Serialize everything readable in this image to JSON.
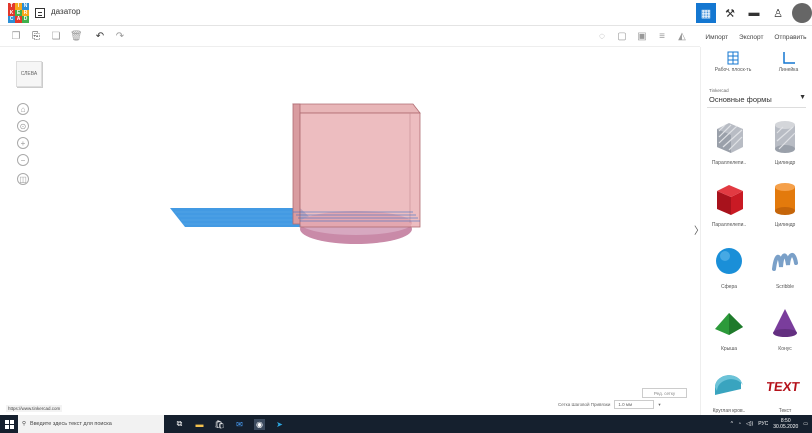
{
  "app": {
    "logo_letters": [
      "T",
      "I",
      "N",
      "K",
      "E",
      "R",
      "C",
      "A",
      "D"
    ],
    "logo_colors": [
      "#e2372b",
      "#f7a71a",
      "#2c8fd6",
      "#e2372b",
      "#3fb04b",
      "#f7a71a",
      "#2c8fd6",
      "#e2372b",
      "#3fb04b"
    ],
    "project_name": "дазатор",
    "accent": "#1477d1"
  },
  "header_right": {
    "icons": [
      "grid-view-icon",
      "hammer-icon",
      "briefcase-icon",
      "add-user-icon"
    ]
  },
  "toolbar": {
    "actions": {
      "import": "Импорт",
      "export": "Экспорт",
      "send": "Отправить"
    }
  },
  "canvas": {
    "viewcube_label": "СЛЕВА",
    "edit_grid_label": "Ред. сетку",
    "snap_label": "Сетка Шаговой Привязки",
    "snap_value": "1.0 мм",
    "url": "https://www.tinkercad.com"
  },
  "panel": {
    "workplane_label": "Рабоч. плоск-ть",
    "ruler_label": "Линейка",
    "library_label": "Tinkercad",
    "library_value": "Основные формы",
    "shapes": [
      {
        "label": "Параллелепи..",
        "icon": "box-hole-icon"
      },
      {
        "label": "Цилиндр",
        "icon": "cylinder-hole-icon"
      },
      {
        "label": "Параллелепи..",
        "icon": "box-icon"
      },
      {
        "label": "Цилиндр",
        "icon": "cylinder-icon"
      },
      {
        "label": "Сфера",
        "icon": "sphere-icon"
      },
      {
        "label": "Scribble",
        "icon": "scribble-icon"
      },
      {
        "label": "Крыша",
        "icon": "roof-icon"
      },
      {
        "label": "Конус",
        "icon": "cone-icon"
      },
      {
        "label": "Круглая кров..",
        "icon": "round-roof-icon"
      },
      {
        "label": "Текст",
        "icon": "text-icon"
      }
    ]
  },
  "taskbar": {
    "search_placeholder": "Введите здесь текст для поиска",
    "language": "РУС",
    "time": "8:50",
    "date": "30.05.2020"
  }
}
